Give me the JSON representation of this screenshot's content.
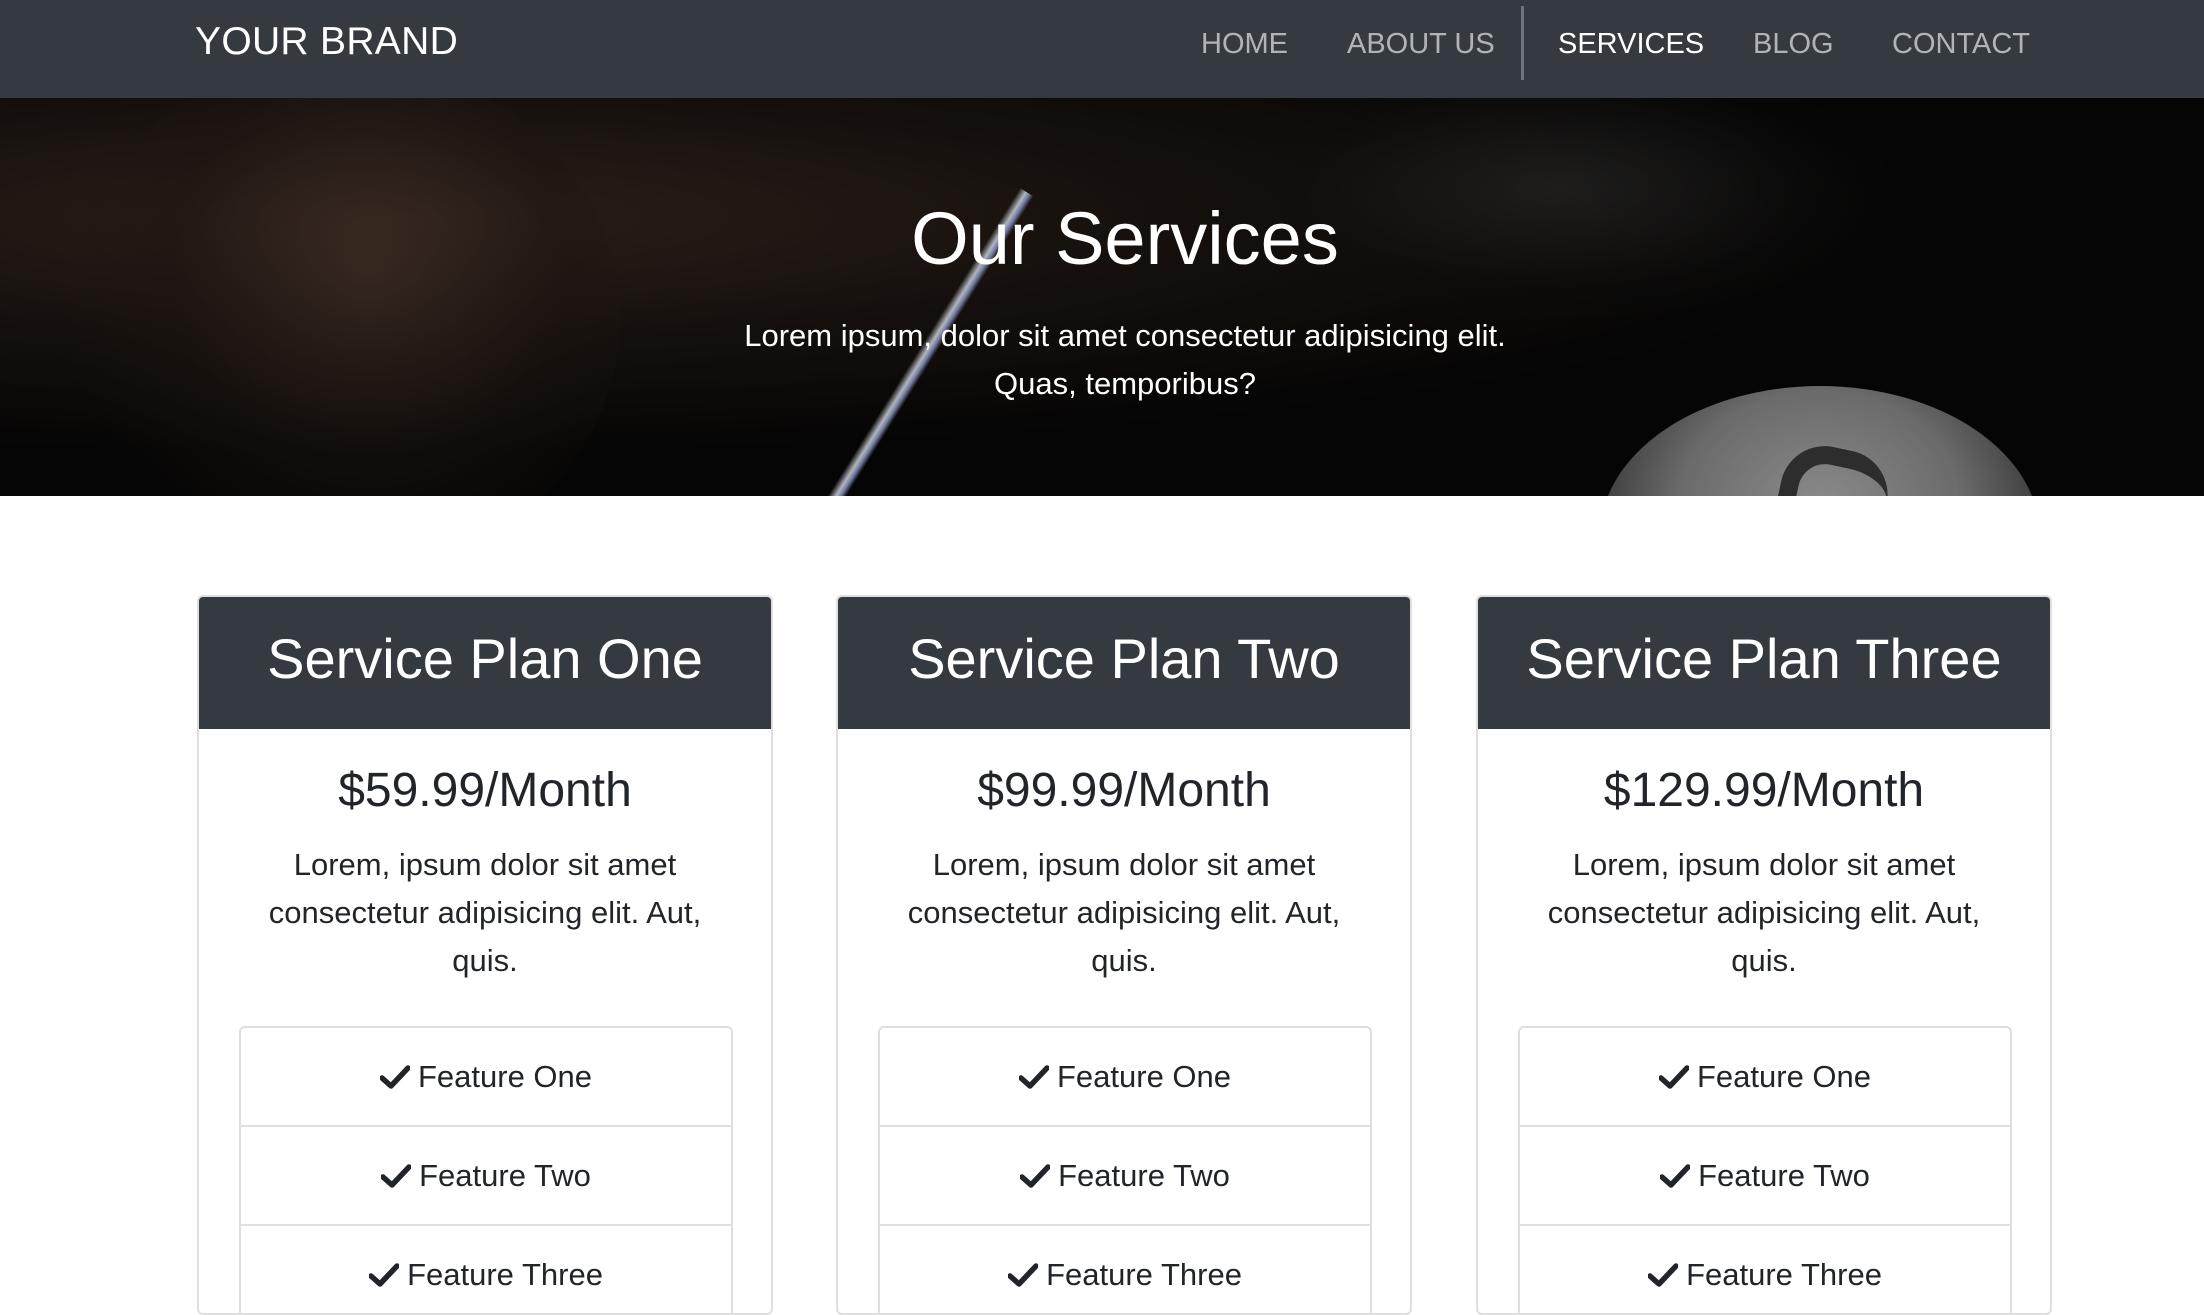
{
  "navbar": {
    "brand": "YOUR BRAND",
    "links": [
      "HOME",
      "ABOUT US",
      "SERVICES",
      "BLOG",
      "CONTACT"
    ],
    "active": "SERVICES"
  },
  "hero": {
    "title": "Our Services",
    "subtitle_line1": "Lorem ipsum, dolor sit amet consectetur adipisicing elit.",
    "subtitle_line2": "Quas, temporibus?"
  },
  "plans": [
    {
      "name": "Service Plan One",
      "price": "$59.99/Month",
      "description": "Lorem, ipsum dolor sit amet consectetur adipisicing elit. Aut, quis.",
      "features": [
        "Feature One",
        "Feature Two",
        "Feature Three"
      ]
    },
    {
      "name": "Service Plan Two",
      "price": "$99.99/Month",
      "description": "Lorem, ipsum dolor sit amet consectetur adipisicing elit. Aut, quis.",
      "features": [
        "Feature One",
        "Feature Two",
        "Feature Three"
      ]
    },
    {
      "name": "Service Plan Three",
      "price": "$129.99/Month",
      "description": "Lorem, ipsum dolor sit amet consectetur adipisicing elit. Aut, quis.",
      "features": [
        "Feature One",
        "Feature Two",
        "Feature Three"
      ]
    }
  ],
  "icons": {
    "feature": "check-icon"
  },
  "colors": {
    "navbar": "#343a40",
    "card_header": "#343a40",
    "text": "#212529"
  }
}
